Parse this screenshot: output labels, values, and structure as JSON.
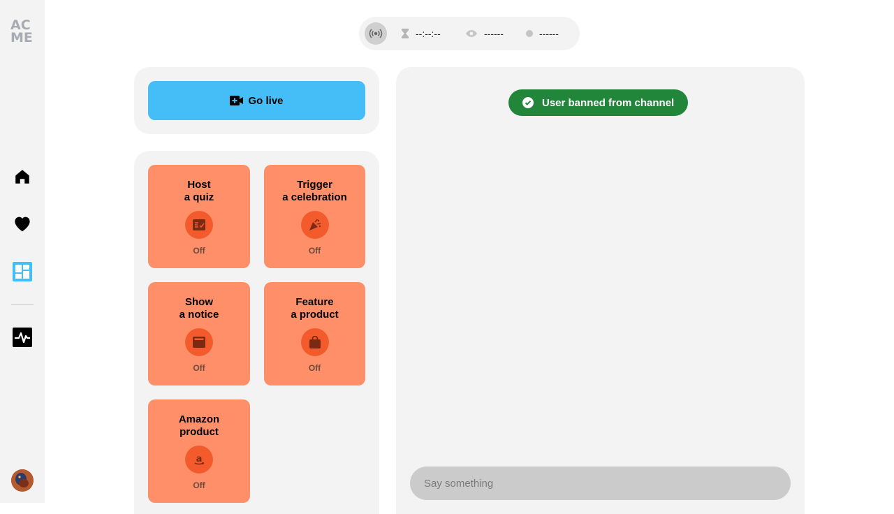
{
  "sidebar": {
    "logo": {
      "line1": "AC",
      "line2": "ME"
    },
    "items": [
      {
        "name": "home",
        "icon": "home-icon",
        "active": false
      },
      {
        "name": "favorites",
        "icon": "heart-icon",
        "active": false
      },
      {
        "name": "dashboard",
        "icon": "dashboard-icon",
        "active": true,
        "color": "#45bdf7"
      },
      {
        "name": "activity",
        "icon": "activity-icon",
        "active": false
      }
    ]
  },
  "status_bar": {
    "broadcast_icon": "broadcast-icon",
    "duration": "--:--:--",
    "viewers": "------",
    "recording": "------"
  },
  "controls": {
    "go_live_label": "Go live",
    "accent": "#45bdf7"
  },
  "features": {
    "tile_color": "#ff8f68",
    "icon_bg": "#f45b2c",
    "tiles": [
      {
        "title": "Host\na quiz",
        "state": "Off",
        "icon": "quiz-icon"
      },
      {
        "title": "Trigger\na celebration",
        "state": "Off",
        "icon": "party-popper-icon"
      },
      {
        "title": "Show\na notice",
        "state": "Off",
        "icon": "notice-icon"
      },
      {
        "title": "Feature\na product",
        "state": "Off",
        "icon": "shopping-bag-icon"
      },
      {
        "title": "Amazon\nproduct",
        "state": "Off",
        "icon": "amazon-icon"
      }
    ]
  },
  "chat": {
    "toast": {
      "text": "User banned from channel",
      "color": "#22863a"
    },
    "input_placeholder": "Say something"
  }
}
